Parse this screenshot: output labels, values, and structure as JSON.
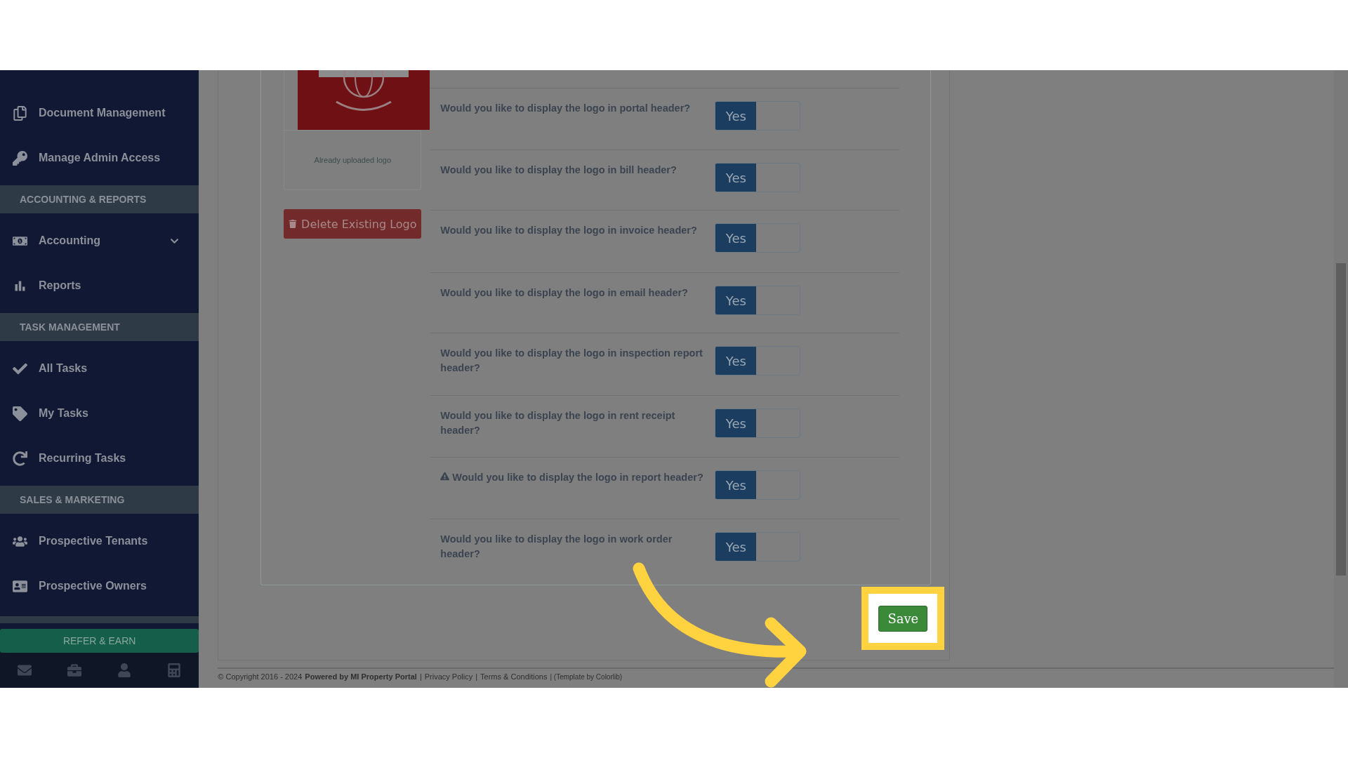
{
  "sidebar": {
    "sections": [
      {
        "kind": "items",
        "items": [
          {
            "label": "Document Management",
            "expandable": false
          },
          {
            "label": "Manage Admin Access",
            "expandable": false
          }
        ]
      },
      {
        "kind": "header",
        "label": "ACCOUNTING & REPORTS"
      },
      {
        "kind": "items",
        "items": [
          {
            "label": "Accounting",
            "expandable": true,
            "expanded": false
          },
          {
            "label": "Reports",
            "expandable": false
          }
        ]
      },
      {
        "kind": "header",
        "label": "TASK MANAGEMENT"
      },
      {
        "kind": "items",
        "items": [
          {
            "label": "All Tasks",
            "expandable": false
          },
          {
            "label": "My Tasks",
            "expandable": false
          },
          {
            "label": "Recurring Tasks",
            "expandable": false
          }
        ]
      },
      {
        "kind": "header",
        "label": "SALES & MARKETING"
      },
      {
        "kind": "items",
        "items": [
          {
            "label": "Prospective Tenants",
            "expandable": false
          },
          {
            "label": "Prospective Owners",
            "expandable": false
          }
        ]
      }
    ],
    "refer_button": "REFER & EARN"
  },
  "logo_panel": {
    "caption": "Already uploaded logo",
    "delete_button": "Delete Existing Logo"
  },
  "settings": [
    {
      "question": "Would you like to display the logo in portal header?",
      "warning": false,
      "toggle": {
        "label": "Yes",
        "on": true
      }
    },
    {
      "question": "Would you like to display the logo in bill header?",
      "warning": false,
      "toggle": {
        "label": "Yes",
        "on": true
      }
    },
    {
      "question": "Would you like to display the logo in invoice header?",
      "warning": false,
      "toggle": {
        "label": "Yes",
        "on": true
      }
    },
    {
      "question": "Would you like to display the logo in email header?",
      "warning": false,
      "toggle": {
        "label": "Yes",
        "on": true
      }
    },
    {
      "question": "Would you like to display the logo in inspection report header?",
      "warning": false,
      "toggle": {
        "label": "Yes",
        "on": true
      }
    },
    {
      "question": "Would you like to display the logo in rent receipt header?",
      "warning": false,
      "toggle": {
        "label": "Yes",
        "on": true
      }
    },
    {
      "question": "Would you like to display the logo in report header?",
      "warning": true,
      "toggle": {
        "label": "Yes",
        "on": true
      }
    },
    {
      "question": "Would you like to display the logo in work order header?",
      "warning": false,
      "toggle": {
        "label": "Yes",
        "on": true
      }
    }
  ],
  "save_button": "Save",
  "footer": [
    {
      "kind": "text",
      "text": "© Copyright 2016 - 2024"
    },
    {
      "kind": "bold",
      "text": "Powered by MI Property Portal"
    },
    {
      "kind": "sep",
      "text": "|"
    },
    {
      "kind": "link",
      "text": "Privacy Policy"
    },
    {
      "kind": "sep",
      "text": "|"
    },
    {
      "kind": "link",
      "text": "Terms & Conditions"
    },
    {
      "kind": "small",
      "text": "| (Template by Colorlib)"
    }
  ]
}
